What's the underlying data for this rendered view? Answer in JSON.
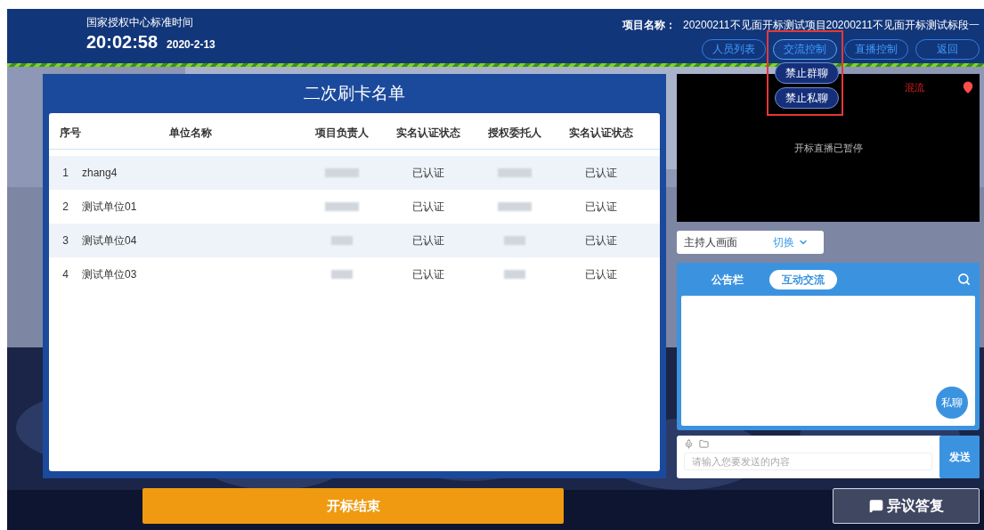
{
  "header": {
    "clock_label": "国家授权中心标准时间",
    "time": "20:02:58",
    "date": "2020-2-13",
    "project_label": "项目名称：",
    "project_name": "20200211不见面开标测试项目20200211不见面开标测试标段一"
  },
  "nav_buttons": [
    {
      "label": "人员列表",
      "expanded": false
    },
    {
      "label": "交流控制",
      "expanded": true,
      "menu": [
        "禁止群聊",
        "禁止私聊"
      ]
    },
    {
      "label": "直播控制",
      "expanded": false
    },
    {
      "label": "返回",
      "expanded": false
    }
  ],
  "table": {
    "title": "二次刷卡名单",
    "columns": [
      "序号",
      "单位名称",
      "项目负责人",
      "实名认证状态",
      "授权委托人",
      "实名认证状态"
    ],
    "rows": [
      {
        "no": "1",
        "unit": "zhang4",
        "leader_status": "已认证",
        "agent_status": "已认证"
      },
      {
        "no": "2",
        "unit": "测试单位01",
        "leader_status": "已认证",
        "agent_status": "已认证"
      },
      {
        "no": "3",
        "unit": "测试单位04",
        "leader_status": "已认证",
        "agent_status": "已认证"
      },
      {
        "no": "4",
        "unit": "测试单位03",
        "leader_status": "已认证",
        "agent_status": "已认证"
      }
    ]
  },
  "video": {
    "mix_label": "混流",
    "status": "开标直播已暂停"
  },
  "host_view": {
    "label": "主持人画面",
    "switch": "切换"
  },
  "chat": {
    "tabs": [
      {
        "label": "公告栏",
        "selected": false
      },
      {
        "label": "互动交流",
        "selected": true
      }
    ],
    "private_button": "私聊"
  },
  "message": {
    "placeholder": "请输入您要发送的内容",
    "send": "发送"
  },
  "finish_button": "开标结束",
  "objection_button": "异议答复"
}
